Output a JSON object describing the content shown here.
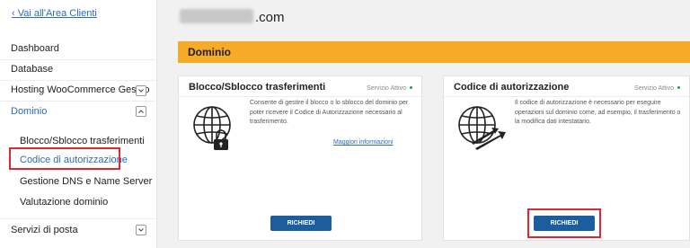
{
  "sidebar": {
    "back_link": "‹ Vai all'Area Clienti",
    "items": [
      {
        "label": "Dashboard"
      },
      {
        "label": "Database"
      },
      {
        "label": "Hosting WooCommerce Gestito"
      },
      {
        "label": "Dominio"
      },
      {
        "label": "Servizi di posta"
      }
    ],
    "sub_items": [
      {
        "label": "Blocco/Sblocco trasferimenti"
      },
      {
        "label": "Codice di autorizzazione"
      },
      {
        "label": "Gestione DNS e Name Server"
      },
      {
        "label": "Valutazione dominio"
      }
    ]
  },
  "main": {
    "domain_suffix": ".com",
    "section_title": "Dominio",
    "cards": [
      {
        "title": "Blocco/Sblocco trasferimenti",
        "status": "Servizio Attivo",
        "description": "Consente di gestire il blocco o lo sblocco del dominio per poter ricevere il Codice di Autorizzazione necessario al trasferimento.",
        "link": "Maggiori informazioni",
        "button": "RICHIEDI",
        "icon": "globe-lock-icon"
      },
      {
        "title": "Codice di autorizzazione",
        "status": "Servizio Attivo",
        "description": "Il codice di autorizzazione è necessario per eseguire operazioni sul dominio come, ad esempio, il trasferimento o la modifica dati intestatario.",
        "button": "RICHIEDI",
        "icon": "globe-arrows-icon"
      }
    ]
  },
  "colors": {
    "accent": "#f7a928",
    "link": "#2a6ab8",
    "button": "#1c5d9e",
    "highlight": "#e0262f",
    "status_ok": "#2f9a44"
  }
}
